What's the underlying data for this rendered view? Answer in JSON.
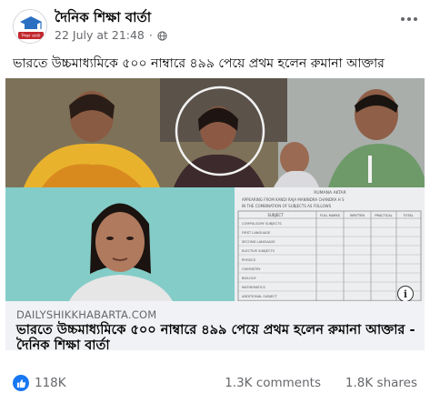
{
  "header": {
    "page_name": "দৈনিক শিক্ষা বার্তা",
    "timestamp": "22 July at 21:48",
    "separator": "·",
    "avatar_text": "শিক্ষা বার্তা"
  },
  "caption": "ভারতে উচ্চমাধ্যমিকে ৫০০ নাম্বারে ৪৯৯ পেয়ে প্রথম হলেন রুমানা আক্তার",
  "link_preview": {
    "domain": "DAILYSHIKKHABARTA.COM",
    "title": "ভারতে উচ্চমাধ্যমিকে ৫০০ নাম্বারে ৪৯৯ পেয়ে প্রথম হলেন রুমানা আক্তার - দৈনিক শিক্ষা বার্তা",
    "info_glyph": "i",
    "marksheet": {
      "heading_lines": [
        "RUMANA AKTAR",
        "APPEARING FROM  KANDI RAJA MANINDRA CHANDRA H S",
        "IN THE COMBINATION OF SUBJECTS AS FOLLOWS"
      ],
      "columns": [
        "SUBJECT",
        "FULL MARKS",
        "WRITTEN",
        "PRACTICAL",
        "TOTAL"
      ],
      "rows": [
        "COMPULSORY SUBJECTS",
        "FIRST LANGUAGE",
        "SECOND LANGUAGE",
        "ELECTIVE SUBJECTS",
        "PHYSICS",
        "CHEMISTRY",
        "BIOLOGY",
        "MATHEMATICS",
        "ADDITIONAL SUBJECT"
      ]
    }
  },
  "stats": {
    "reactions": "118K",
    "comments": "1.3K comments",
    "shares": "1.8K shares"
  },
  "colors": {
    "brand_blue": "#1877f2",
    "secondary_text": "#65676b",
    "preview_footer_bg": "#f0f2f5"
  },
  "icons": {
    "globe": "globe-icon",
    "more": "more-options-icon",
    "like": "like-icon",
    "info": "info-icon"
  }
}
